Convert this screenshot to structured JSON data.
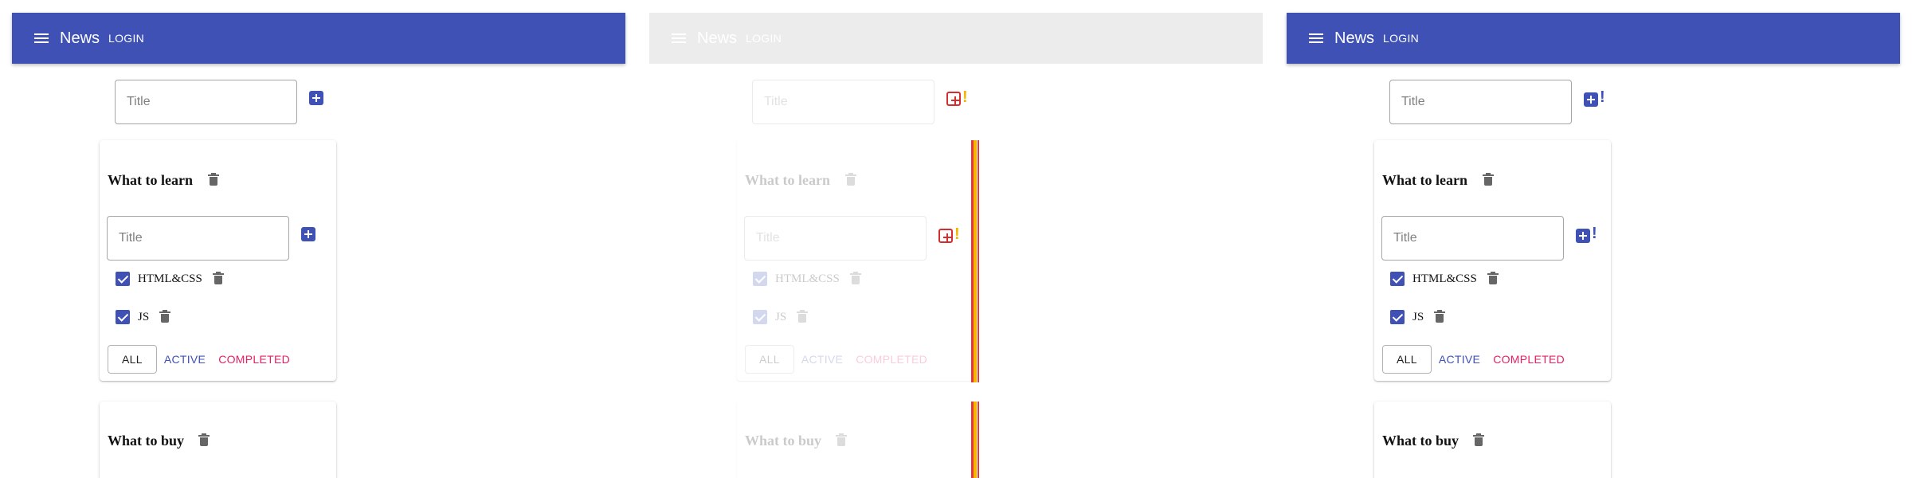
{
  "panels": [
    {
      "appbar": {
        "title": "News",
        "login_label": "LOGIN"
      },
      "new_list_placeholder": "Title",
      "lists": [
        {
          "title": "What to learn",
          "new_task_placeholder": "Title",
          "tasks": [
            {
              "label": "HTML&CSS",
              "checked": true
            },
            {
              "label": "JS",
              "checked": true
            }
          ],
          "filters": {
            "all": "ALL",
            "active": "ACTIVE",
            "completed": "COMPLETED"
          }
        },
        {
          "title": "What to buy"
        }
      ]
    },
    {
      "appbar": {
        "title": "News",
        "login_label": "LOGIN"
      },
      "new_list_placeholder": "Title",
      "lists": [
        {
          "title": "What to learn",
          "new_task_placeholder": "Title",
          "tasks": [
            {
              "label": "HTML&CSS",
              "checked": true
            },
            {
              "label": "JS",
              "checked": true
            }
          ],
          "filters": {
            "all": "ALL",
            "active": "ACTIVE",
            "completed": "COMPLETED"
          }
        },
        {
          "title": "What to buy"
        }
      ],
      "warning_mark": "!"
    },
    {
      "appbar": {
        "title": "News",
        "login_label": "LOGIN"
      },
      "new_list_placeholder": "Title",
      "lists": [
        {
          "title": "What to learn",
          "new_task_placeholder": "Title",
          "tasks": [
            {
              "label": "HTML&CSS",
              "checked": true
            },
            {
              "label": "JS",
              "checked": true
            }
          ],
          "filters": {
            "all": "ALL",
            "active": "ACTIVE",
            "completed": "COMPLETED"
          }
        },
        {
          "title": "What to buy"
        }
      ],
      "warning_mark": "!"
    }
  ],
  "colors": {
    "primary": "#3f51b5",
    "secondary": "#e91e63",
    "icon_grey": "#666666",
    "error_red": "#e53935",
    "warning_yellow": "#f5b400"
  }
}
